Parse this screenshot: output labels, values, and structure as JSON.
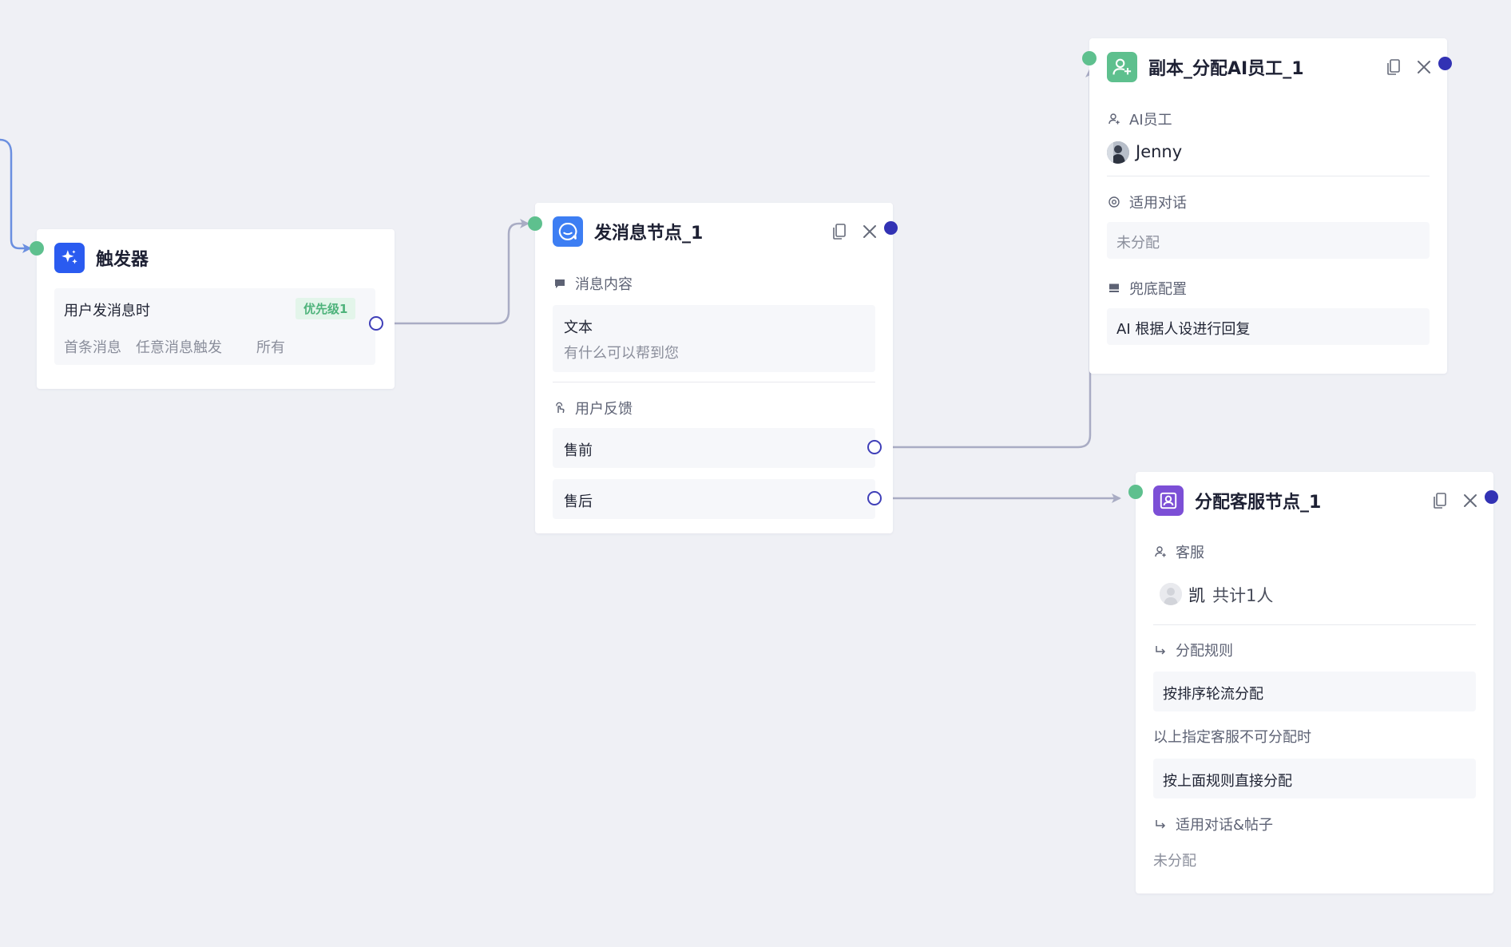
{
  "trigger": {
    "title": "触发器",
    "event": "用户发消息时",
    "priority": "优先级1",
    "conditions": [
      "首条消息",
      "任意消息触发",
      "所有"
    ]
  },
  "send_message": {
    "title": "发消息节点_1",
    "content_label": "消息内容",
    "content_type": "文本",
    "content_text": "有什么可以帮到您",
    "feedback_label": "用户反馈",
    "options": [
      "售前",
      "售后"
    ]
  },
  "assign_ai": {
    "title": "副本_分配AI员工_1",
    "employee_label": "AI员工",
    "employee_name": "Jenny",
    "dialog_label": "适用对话",
    "dialog_value": "未分配",
    "fallback_label": "兜底配置",
    "fallback_value": "AI 根据人设进行回复"
  },
  "assign_cs": {
    "title": "分配客服节点_1",
    "agent_label": "客服",
    "agent_name": "凯",
    "agent_count": "共计1人",
    "rule_label": "分配规则",
    "rule_value": "按排序轮流分配",
    "unavailable_text": "以上指定客服不可分配时",
    "unavailable_value": "按上面规则直接分配",
    "scope_label": "适用对话&帖子",
    "scope_value": "未分配"
  },
  "colors": {
    "canvas": "#eff0f5",
    "edge": "#a9acc4",
    "edge_incoming": "#6b8fe0",
    "port_in": "#5ec08e",
    "port_out": "#3232b4",
    "trigger_icon": "#2a5bf0",
    "message_icon": "#3d7ef3",
    "ai_icon": "#5ec08e",
    "cs_icon": "#7c4fd6"
  },
  "icons": {
    "trigger": "sparkle-icon",
    "message": "chat-bubble-icon",
    "ai_employee": "person-add-icon",
    "customer_service": "person-badge-icon",
    "copy": "copy-icon",
    "close": "close-icon"
  }
}
